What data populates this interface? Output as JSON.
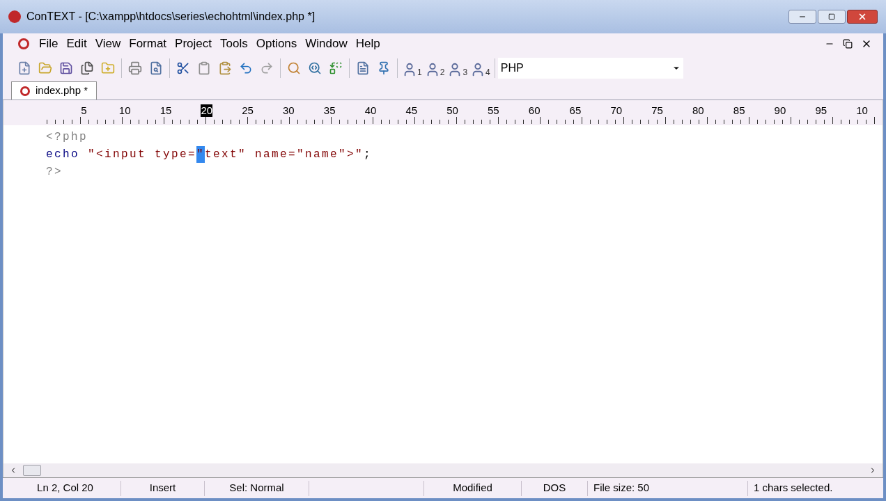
{
  "window": {
    "title": "ConTEXT - [C:\\xampp\\htdocs\\series\\echohtml\\index.php *]"
  },
  "menu": [
    "File",
    "Edit",
    "View",
    "Format",
    "Project",
    "Tools",
    "Options",
    "Window",
    "Help"
  ],
  "toolbar": {
    "user_tools": [
      "1",
      "2",
      "3",
      "4"
    ],
    "language": "PHP"
  },
  "tabs": [
    {
      "label": "index.php *",
      "selected": true
    }
  ],
  "ruler": [
    {
      "label": "5",
      "selected": false
    },
    {
      "label": "10",
      "selected": false
    },
    {
      "label": "15",
      "selected": false
    },
    {
      "label": "20",
      "selected": true
    },
    {
      "label": "25",
      "selected": false
    },
    {
      "label": "30",
      "selected": false
    },
    {
      "label": "35",
      "selected": false
    },
    {
      "label": "40",
      "selected": false
    },
    {
      "label": "45",
      "selected": false
    },
    {
      "label": "50",
      "selected": false
    },
    {
      "label": "55",
      "selected": false
    },
    {
      "label": "60",
      "selected": false
    },
    {
      "label": "65",
      "selected": false
    },
    {
      "label": "70",
      "selected": false
    },
    {
      "label": "75",
      "selected": false
    },
    {
      "label": "80",
      "selected": false
    },
    {
      "label": "85",
      "selected": false
    },
    {
      "label": "90",
      "selected": false
    },
    {
      "label": "95",
      "selected": false
    },
    {
      "label": "10",
      "selected": false
    }
  ],
  "code": [
    [
      {
        "text": "<?php",
        "kind": "tag",
        "selected": false
      }
    ],
    [
      {
        "text": "echo",
        "kind": "keyword",
        "selected": false
      },
      {
        "text": " \"<input type=",
        "kind": "string",
        "selected": false
      },
      {
        "text": "\"",
        "kind": "string",
        "selected": true
      },
      {
        "text": "text\" name=\"name\">\"",
        "kind": "string",
        "selected": false
      },
      {
        "text": ";",
        "kind": "symbol",
        "selected": false
      }
    ],
    [
      {
        "text": "?>",
        "kind": "tag",
        "selected": false
      }
    ]
  ],
  "status_bar": [
    "Ln 2, Col 20",
    "Insert",
    "Sel: Normal",
    "Modified",
    "DOS",
    "File size: 50",
    "1 chars selected."
  ]
}
